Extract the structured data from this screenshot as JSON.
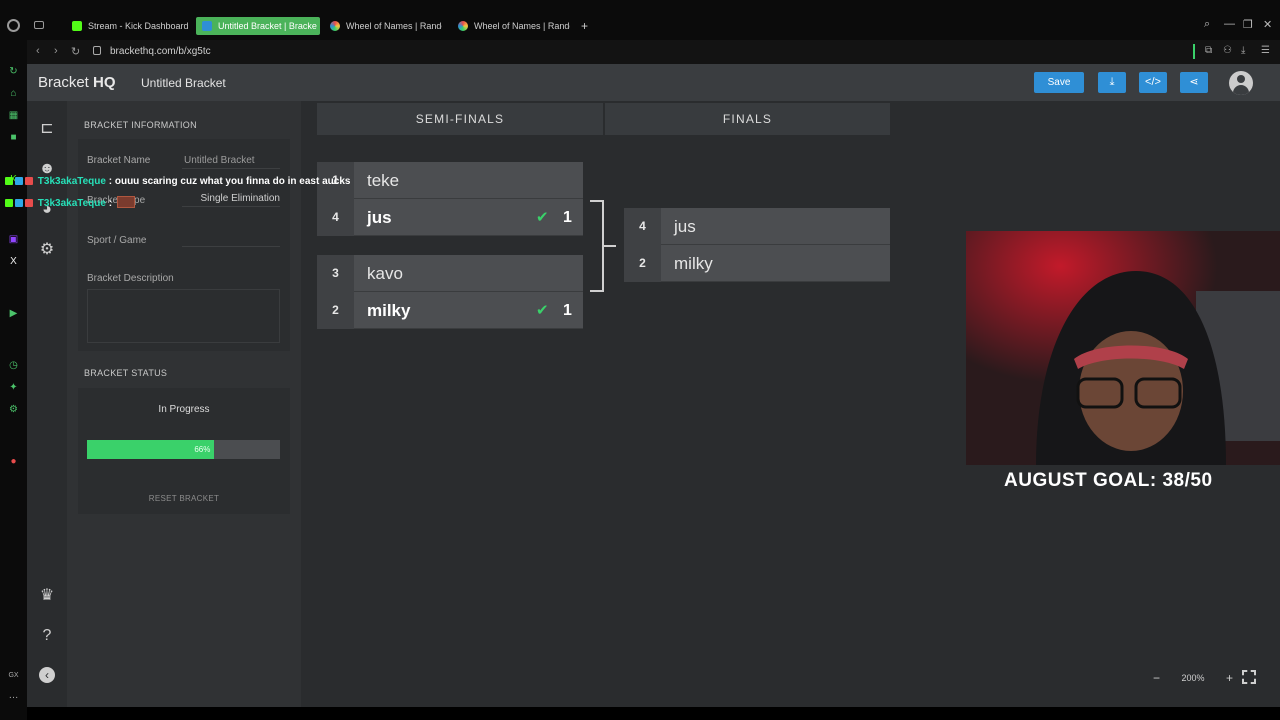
{
  "browser": {
    "tabs": [
      {
        "label": "Stream - Kick Dashboard",
        "color": "#53fc18"
      },
      {
        "label": "Untitled Bracket | Bracke",
        "color": "#2f8fd6",
        "active": true
      },
      {
        "label": "Wheel of Names | Rando",
        "color": "#e84c4c"
      },
      {
        "label": "Wheel of Names | Rando",
        "color": "#e84c4c"
      }
    ],
    "new_tab": "+",
    "url": "brackethq.com/b/xg5tc"
  },
  "app": {
    "logo_a": "Bracket ",
    "logo_b": "HQ",
    "doc_title": "Untitled Bracket",
    "save_label": "Save",
    "accent": "#2f8fd6"
  },
  "panel": {
    "info_title": "BRACKET INFORMATION",
    "name_label": "Bracket Name",
    "name_value": "Untitled Bracket",
    "type_label": "Bracket Type",
    "type_value": "Single Elimination",
    "sport_label": "Sport / Game",
    "sport_value": "",
    "desc_label": "Bracket Description",
    "status_title": "BRACKET STATUS",
    "status_value": "In Progress",
    "progress_percent": 66,
    "progress_label": "66%",
    "reset_label": "RESET BRACKET"
  },
  "rounds": [
    {
      "label": "SEMI-FINALS"
    },
    {
      "label": "FINALS"
    }
  ],
  "matches": {
    "semi1": {
      "top": {
        "seed": "1",
        "name": "teke"
      },
      "bottom": {
        "seed": "4",
        "name": "jus",
        "score": "1",
        "winner": true
      }
    },
    "semi2": {
      "top": {
        "seed": "3",
        "name": "kavo"
      },
      "bottom": {
        "seed": "2",
        "name": "milky",
        "score": "1",
        "winner": true
      }
    },
    "final": {
      "top": {
        "seed": "4",
        "name": "jus"
      },
      "bottom": {
        "seed": "2",
        "name": "milky"
      }
    }
  },
  "chat": [
    {
      "user": "T3k3akaTeque",
      "msg": " : ouuu scaring cuz what you finna do in east aucks"
    },
    {
      "user": "T3k3akaTeque",
      "msg": " : "
    }
  ],
  "overlay": {
    "goal": "AUGUST GOAL: 38/50"
  },
  "zoom": {
    "minus": "−",
    "level": "200%",
    "plus": "+"
  }
}
